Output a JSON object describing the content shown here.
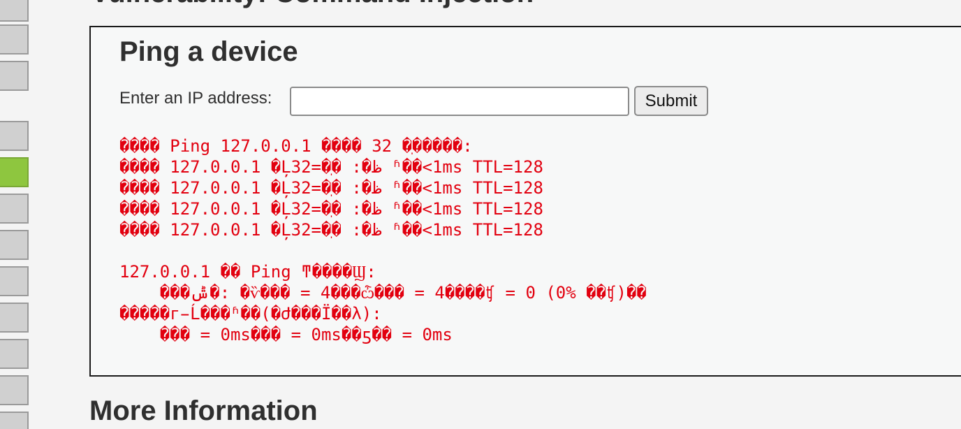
{
  "header": {
    "title": "Vulnerability: Command Injection"
  },
  "menu": {
    "active_index": 4,
    "item_count": 12
  },
  "form": {
    "heading": "Ping a device",
    "ip_label": "Enter an IP address:",
    "ip_value": "",
    "submit_label": "Submit"
  },
  "output": {
    "lines": [
      "���� Ping 127.0.0.1 ���� 32 �ֽ�����:",
      "���� 127.0.0.1 �Ļظ�: �ֽ�=32 ʱ��<1ms TTL=128",
      "���� 127.0.0.1 �Ļظ�: �ֽ�=32 ʱ��<1ms TTL=128",
      "���� 127.0.0.1 �Ļظ�: �ֽ�=32 ʱ��<1ms TTL=128",
      "���� 127.0.0.1 �Ļظ�: �ֽ�=32 ʱ��<1ms TTL=128",
      "",
      "127.0.0.1 �� Ping ͳ����Ϣ:",
      "    ���ݰ�: �ѷ��� = 4���ѽ��� = 4����ʧ = 0 (0% ��ʧ)��",
      "�����г̵Ĺ���ʱ��(�Ժ���Ϊ��λ):",
      "    ��� = 0ms��� = 0ms��ƽ�� = 0ms"
    ],
    "color": "#e2000f"
  },
  "footer": {
    "more_info_heading": "More Information"
  },
  "colors": {
    "menu_active": "#8ec63f",
    "menu_default": "#d0d0d0",
    "page_background": "#f4f4f4"
  }
}
